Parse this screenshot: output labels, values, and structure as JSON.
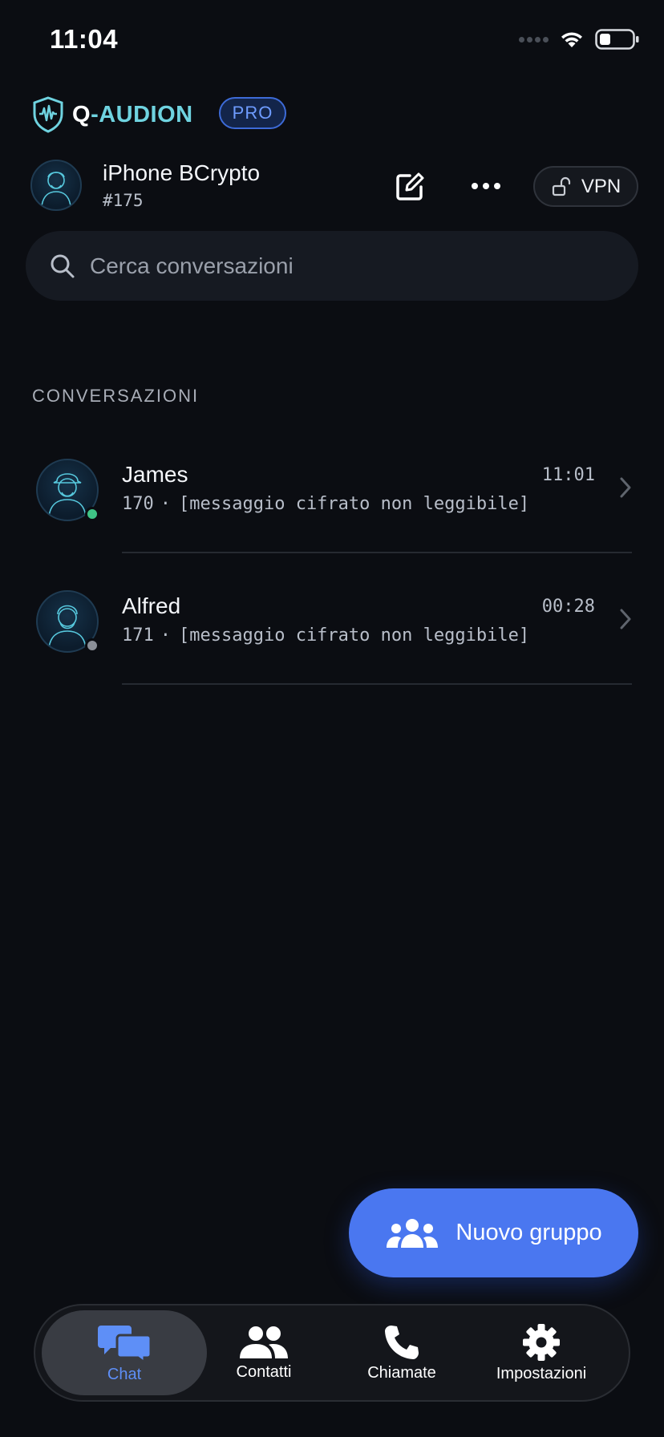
{
  "status_bar": {
    "time": "11:04"
  },
  "brand": {
    "name_q": "Q",
    "name_rest": "-AUDION",
    "badge": "PRO"
  },
  "profile": {
    "name": "iPhone BCrypto",
    "id": "#175"
  },
  "vpn_button": {
    "label": "VPN"
  },
  "search": {
    "placeholder": "Cerca conversazioni"
  },
  "section_title": "CONVERSAZIONI",
  "conversations": [
    {
      "name": "James",
      "time": "11:01",
      "number": "170",
      "preview": "[messaggio cifrato non leggibile]",
      "online": true,
      "status_color": "#3fc486"
    },
    {
      "name": "Alfred",
      "time": "00:28",
      "number": "171",
      "preview": "[messaggio cifrato non leggibile]",
      "online": false,
      "status_color": "#8b8f98"
    }
  ],
  "fab": {
    "label": "Nuovo gruppo"
  },
  "tabbar": {
    "items": [
      {
        "label": "Chat",
        "icon": "chat-bubbles-icon",
        "active": true
      },
      {
        "label": "Contatti",
        "icon": "contacts-icon",
        "active": false
      },
      {
        "label": "Chiamate",
        "icon": "phone-icon",
        "active": false
      },
      {
        "label": "Impostazioni",
        "icon": "gear-icon",
        "active": false
      }
    ]
  },
  "colors": {
    "accent": "#4a77f0",
    "brand_cyan": "#6fd3e0",
    "background": "#0b0d12",
    "active_tab": "#5e8ff7"
  }
}
